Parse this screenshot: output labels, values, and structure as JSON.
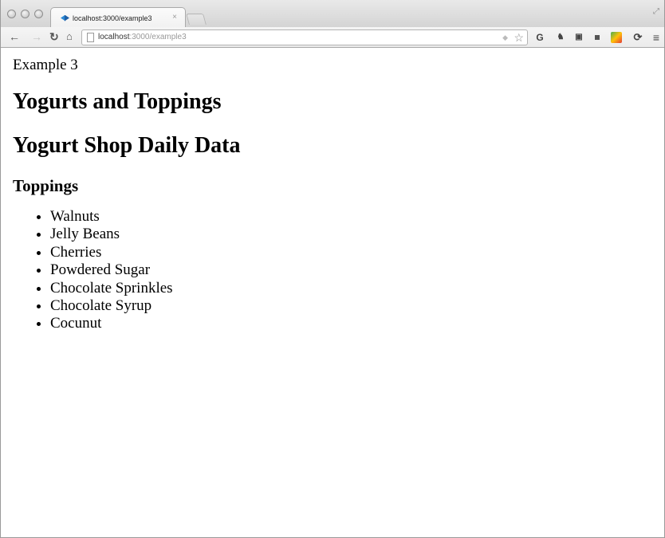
{
  "browser": {
    "tab_title": "localhost:3000/example3",
    "tab_close": "×",
    "url_host": "localhost",
    "url_path": ":3000/example3"
  },
  "page": {
    "example_label": "Example 3",
    "title": "Yogurts and Toppings",
    "subtitle": "Yogurt Shop Daily Data",
    "section_heading": "Toppings",
    "toppings": [
      "Walnuts",
      "Jelly Beans",
      "Cherries",
      "Powdered Sugar",
      "Chocolate Sprinkles",
      "Chocolate Syrup",
      "Cocunut"
    ]
  },
  "icons": {
    "back": "arrow-left-icon",
    "forward": "arrow-right-icon",
    "reload": "reload-icon",
    "home": "home-icon",
    "bookmark": "star-icon",
    "menu": "menu-icon"
  }
}
